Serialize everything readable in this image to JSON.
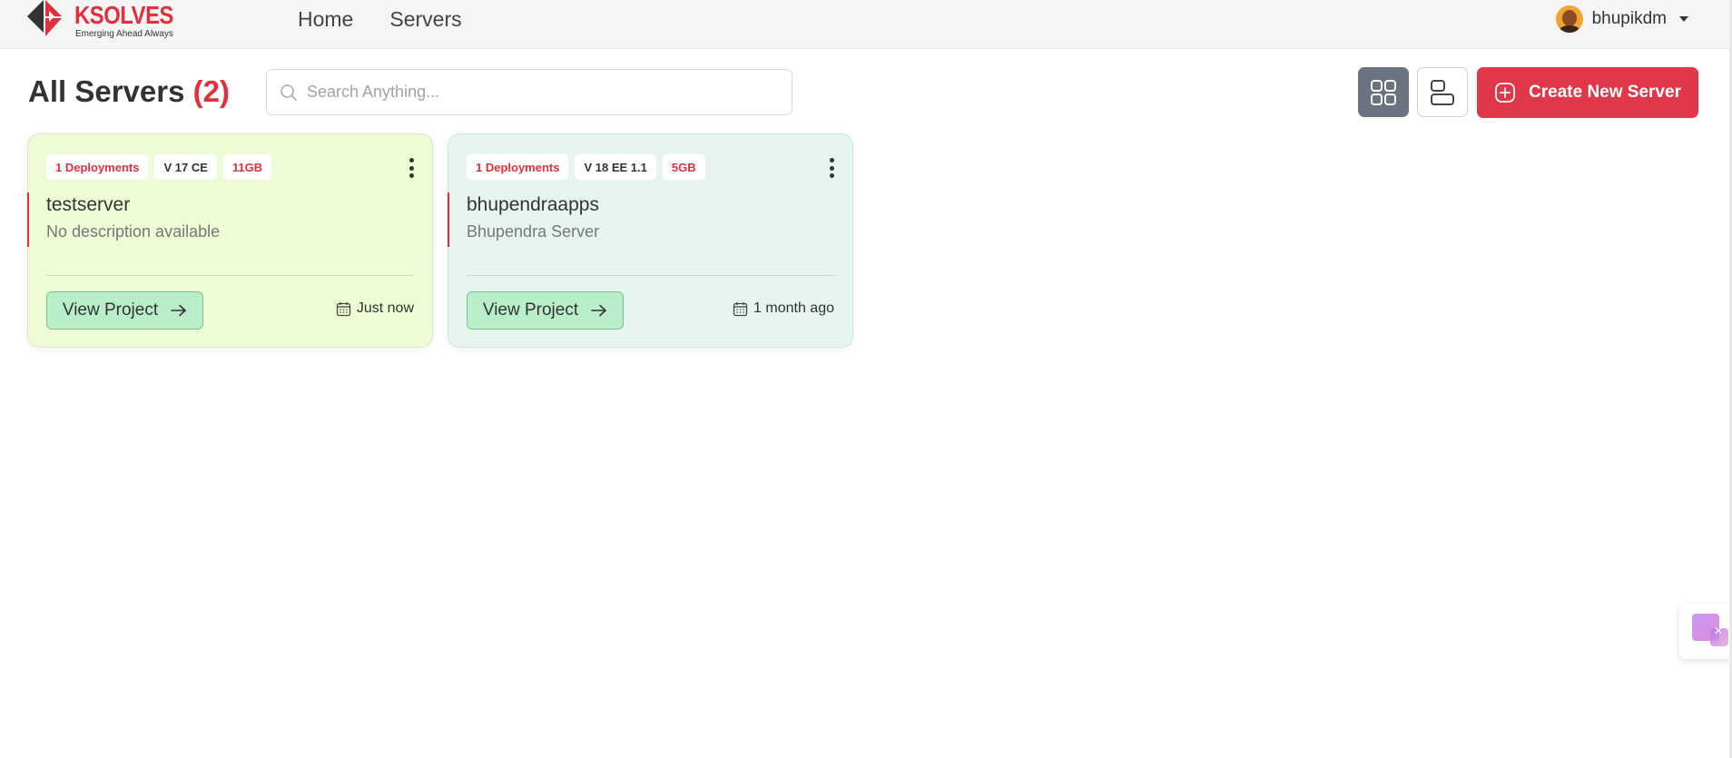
{
  "brand": {
    "name": "KSOLVES",
    "tagline": "Emerging Ahead Always",
    "accent_color": "#e0303e"
  },
  "nav": {
    "items": [
      {
        "label": "Home"
      },
      {
        "label": "Servers"
      }
    ]
  },
  "user": {
    "name": "bhupikdm"
  },
  "header": {
    "title": "All Servers",
    "count": "(2)"
  },
  "search": {
    "placeholder": "Search Anything..."
  },
  "toolbar": {
    "grid_view_icon": "grid-icon",
    "list_view_icon": "list-icon",
    "active_view": "grid",
    "create_label": "Create New Server"
  },
  "servers": [
    {
      "deployments": "1 Deployments",
      "version": "V 17 CE",
      "size": "11GB",
      "name": "testserver",
      "description": "No description available",
      "action_label": "View Project",
      "updated": "Just now",
      "card_color": "#eefcd6"
    },
    {
      "deployments": "1 Deployments",
      "version": "V 18 EE 1.1",
      "size": "5GB",
      "name": "bhupendraapps",
      "description": "Bhupendra Server",
      "action_label": "View Project",
      "updated": "1 month ago",
      "card_color": "#e6f6ee"
    }
  ]
}
